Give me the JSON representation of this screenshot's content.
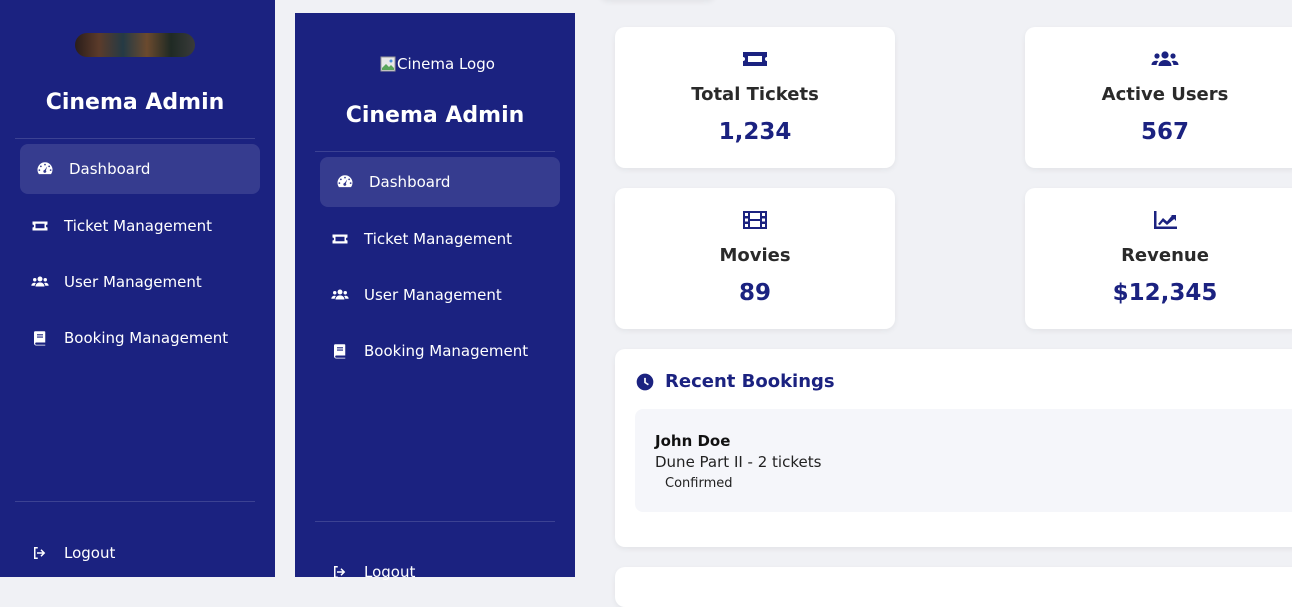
{
  "sidebar_left": {
    "title": "Cinema Admin",
    "nav": [
      {
        "label": "Dashboard",
        "icon": "dashboard-icon",
        "active": true
      },
      {
        "label": "Ticket Management",
        "icon": "ticket-icon"
      },
      {
        "label": "User Management",
        "icon": "users-icon"
      },
      {
        "label": "Booking Management",
        "icon": "book-icon"
      }
    ],
    "logout": "Logout"
  },
  "sidebar_main": {
    "logo_alt": "Cinema Logo",
    "title": "Cinema Admin",
    "nav": [
      {
        "label": "Dashboard",
        "icon": "dashboard-icon",
        "active": true
      },
      {
        "label": "Ticket Management",
        "icon": "ticket-icon"
      },
      {
        "label": "User Management",
        "icon": "users-icon"
      },
      {
        "label": "Booking Management",
        "icon": "book-icon"
      }
    ],
    "logout": "Logout"
  },
  "stats": [
    {
      "label": "Total Tickets",
      "value": "1,234",
      "icon": "ticket-icon"
    },
    {
      "label": "Active Users",
      "value": "567",
      "icon": "users-icon"
    },
    {
      "label": "Movies",
      "value": "89",
      "icon": "film-icon"
    },
    {
      "label": "Revenue",
      "value": "$12,345",
      "icon": "chart-line-icon"
    }
  ],
  "recent_bookings": {
    "title": "Recent Bookings",
    "icon": "clock-icon",
    "items": [
      {
        "name": "John Doe",
        "detail": "Dune Part II - 2 tickets",
        "status": "Confirmed"
      }
    ]
  },
  "colors": {
    "primary": "#1b2280",
    "background": "#f0f1f5"
  }
}
